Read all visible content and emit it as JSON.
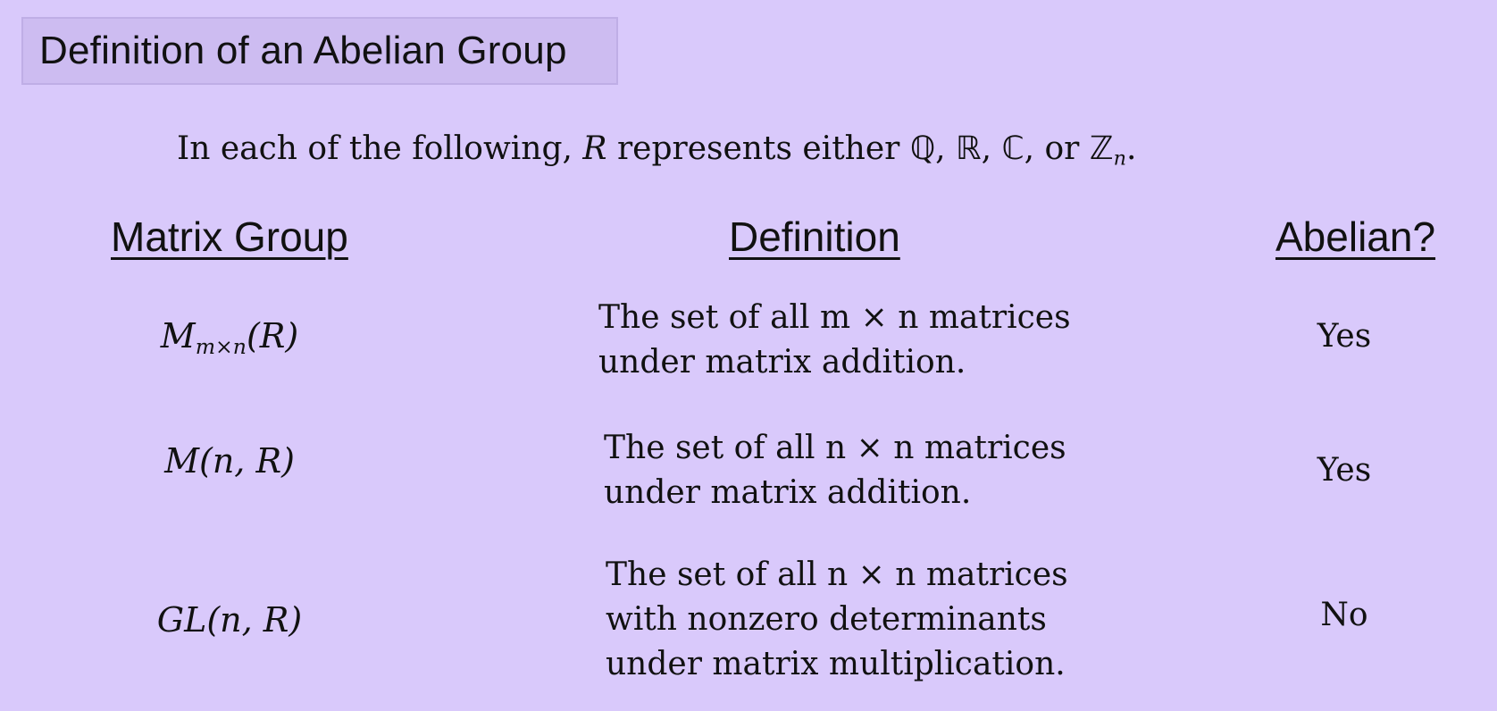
{
  "title": "Definition of an Abelian Group",
  "intro": {
    "prefix": "In each of the following, ",
    "variable": "R",
    "middle": " represents either ",
    "sets": [
      "ℚ",
      "ℝ",
      "ℂ",
      "ℤ"
    ],
    "subscript": "n",
    "or_text": "or"
  },
  "headers": {
    "group": "Matrix Group",
    "definition": "Definition",
    "abelian": "Abelian?"
  },
  "rows": [
    {
      "group_base": "M",
      "group_sub": "m×n",
      "group_tail": "(R)",
      "definition_lines": [
        "The set of all m × n matrices",
        "under matrix addition."
      ],
      "abelian": "Yes"
    },
    {
      "group": "M(n, R)",
      "definition_lines": [
        "The set of all n × n matrices",
        "under matrix addition."
      ],
      "abelian": "Yes"
    },
    {
      "group": "GL(n, R)",
      "definition_lines": [
        "The set of all n × n matrices",
        "with nonzero determinants",
        "under matrix multiplication."
      ],
      "abelian": "No"
    }
  ]
}
